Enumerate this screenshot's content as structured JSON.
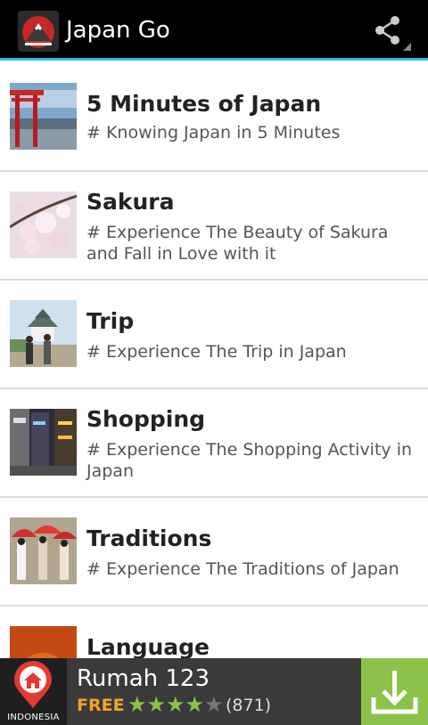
{
  "app": {
    "title": "Japan Go",
    "icon": "app-logo-icon",
    "share_icon": "share-icon",
    "accent_color": "#33b5e5"
  },
  "list": {
    "items": [
      {
        "title": "5 Minutes of Japan",
        "subtitle": "# Knowing Japan in 5 Minutes",
        "thumbnail": "torii-gate-thumbnail"
      },
      {
        "title": "Sakura",
        "subtitle": "# Experience The Beauty of Sakura and Fall in Love with it",
        "thumbnail": "cherry-blossom-thumbnail"
      },
      {
        "title": "Trip",
        "subtitle": "# Experience The Trip in Japan",
        "thumbnail": "castle-thumbnail"
      },
      {
        "title": "Shopping",
        "subtitle": "# Experience The Shopping Activity in Japan",
        "thumbnail": "shopping-street-thumbnail"
      },
      {
        "title": "Traditions",
        "subtitle": "# Experience The Traditions of Japan",
        "thumbnail": "umbrellas-thumbnail"
      },
      {
        "title": "Language",
        "subtitle": "",
        "thumbnail": "sunset-thumbnail"
      }
    ]
  },
  "ad": {
    "logo_label": "INDONESIA",
    "title": "Rumah 123",
    "price": "FREE",
    "rating_stars": 4,
    "rating_max": 5,
    "rating_count": "(871)",
    "download_icon": "download-icon",
    "accent_color": "#8bc34a"
  }
}
